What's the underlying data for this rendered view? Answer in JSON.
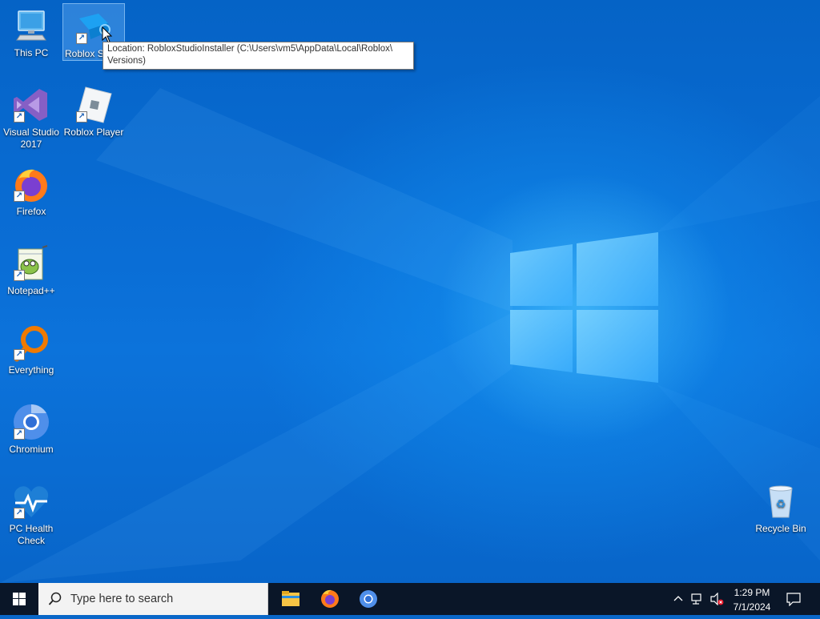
{
  "desktop": {
    "icons": [
      {
        "label": "This PC",
        "name": "this-pc"
      },
      {
        "label": "Roblox S",
        "name": "roblox-studio"
      },
      {
        "label": "Visual Studio 2017",
        "name": "visual-studio-2017"
      },
      {
        "label": "Roblox Player",
        "name": "roblox-player"
      },
      {
        "label": "Firefox",
        "name": "firefox"
      },
      {
        "label": "Notepad++",
        "name": "notepad-plus-plus"
      },
      {
        "label": "Everything",
        "name": "everything"
      },
      {
        "label": "Chromium",
        "name": "chromium"
      },
      {
        "label": "PC Health Check",
        "name": "pc-health-check"
      },
      {
        "label": "Recycle Bin",
        "name": "recycle-bin"
      }
    ],
    "tooltip": "Location: RobloxStudioInstaller (C:\\Users\\vm5\\AppData\\Local\\Roblox\\ Versions)"
  },
  "taskbar": {
    "search_placeholder": "Type here to search",
    "pinned": [
      "File Explorer",
      "Firefox",
      "Chromium"
    ],
    "clock": {
      "time": "1:29 PM",
      "date": "7/1/2024"
    }
  },
  "colors": {
    "accent": "#0a67c8",
    "taskbar": "#0a1628"
  }
}
